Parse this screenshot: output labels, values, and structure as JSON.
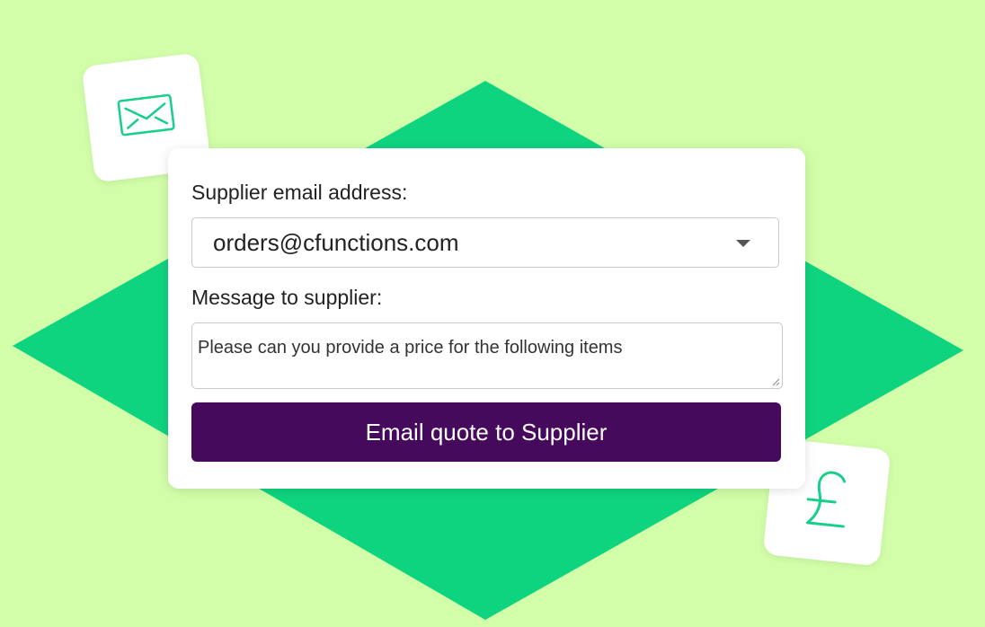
{
  "colors": {
    "background": "#d2fea9",
    "diamond": "#0fd47f",
    "button": "#460a5c",
    "icon_stroke": "#16cf8a"
  },
  "icons": {
    "top_left": "mail-icon",
    "bottom_right": "pound-sterling-icon"
  },
  "form": {
    "email_label": "Supplier email address:",
    "email_value": "orders@cfunctions.com",
    "message_label": "Message to supplier:",
    "message_value": "Please can you provide a price for the following items",
    "submit_label": "Email quote to Supplier"
  }
}
